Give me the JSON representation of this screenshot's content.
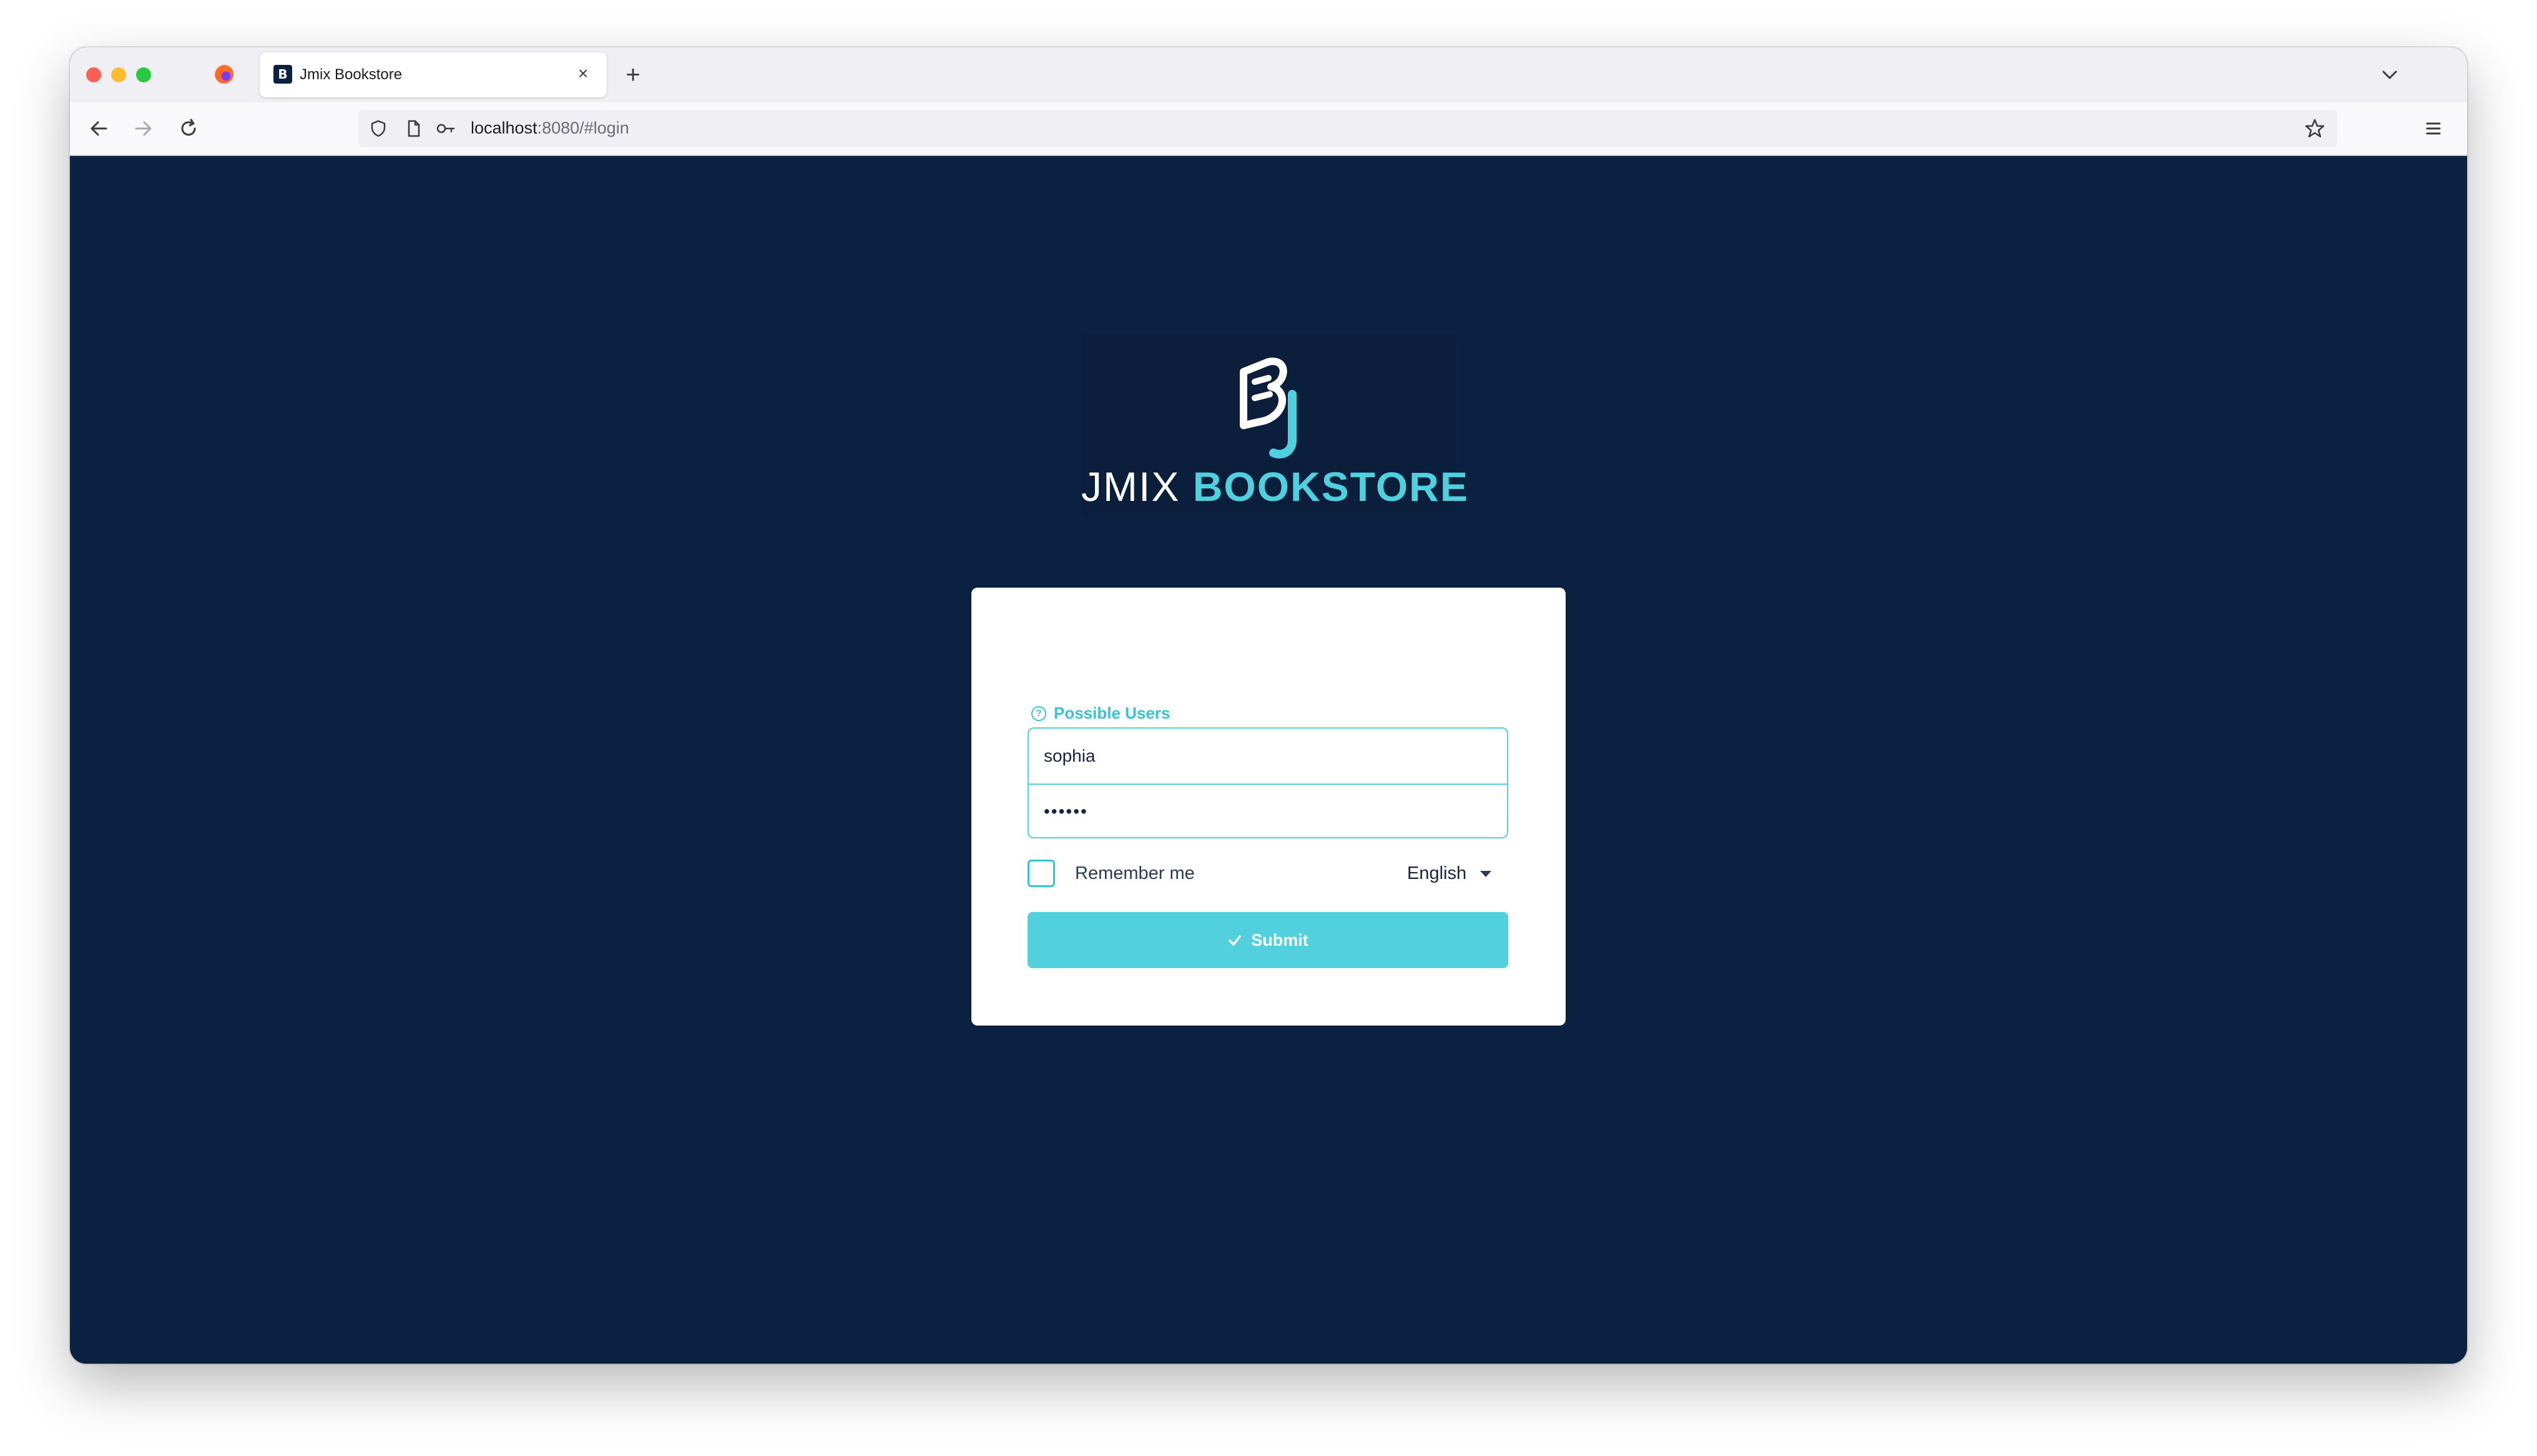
{
  "browser": {
    "tab": {
      "title": "Jmix Bookstore",
      "favicon_letter": "B",
      "close_symbol": "×"
    },
    "new_tab_symbol": "+",
    "url": {
      "host": "localhost",
      "rest": ":8080/#login"
    }
  },
  "login": {
    "logo": {
      "word_jmix": "JMIX",
      "word_bookstore": "BOOKSTORE"
    },
    "possible_users_label": "Possible Users",
    "username_value": "sophia",
    "password_value": "••••••",
    "remember_me_label": "Remember me",
    "remember_me_checked": false,
    "language_selected": "English",
    "submit_label": "Submit"
  },
  "colors": {
    "page_background": "#0a2142",
    "accent": "#4fd0df",
    "submit_button": "#52d0de"
  },
  "icons": {
    "tab_bar": [
      "firefox-icon",
      "jmix-favicon",
      "close-icon",
      "plus-icon",
      "chevron-down-icon"
    ],
    "nav_bar": [
      "back-arrow-icon",
      "forward-arrow-icon",
      "reload-icon",
      "shield-icon",
      "page-icon",
      "key-icon",
      "star-icon",
      "hamburger-menu-icon"
    ],
    "login": [
      "question-circle-icon",
      "caret-down-icon",
      "checkmark-icon"
    ]
  }
}
